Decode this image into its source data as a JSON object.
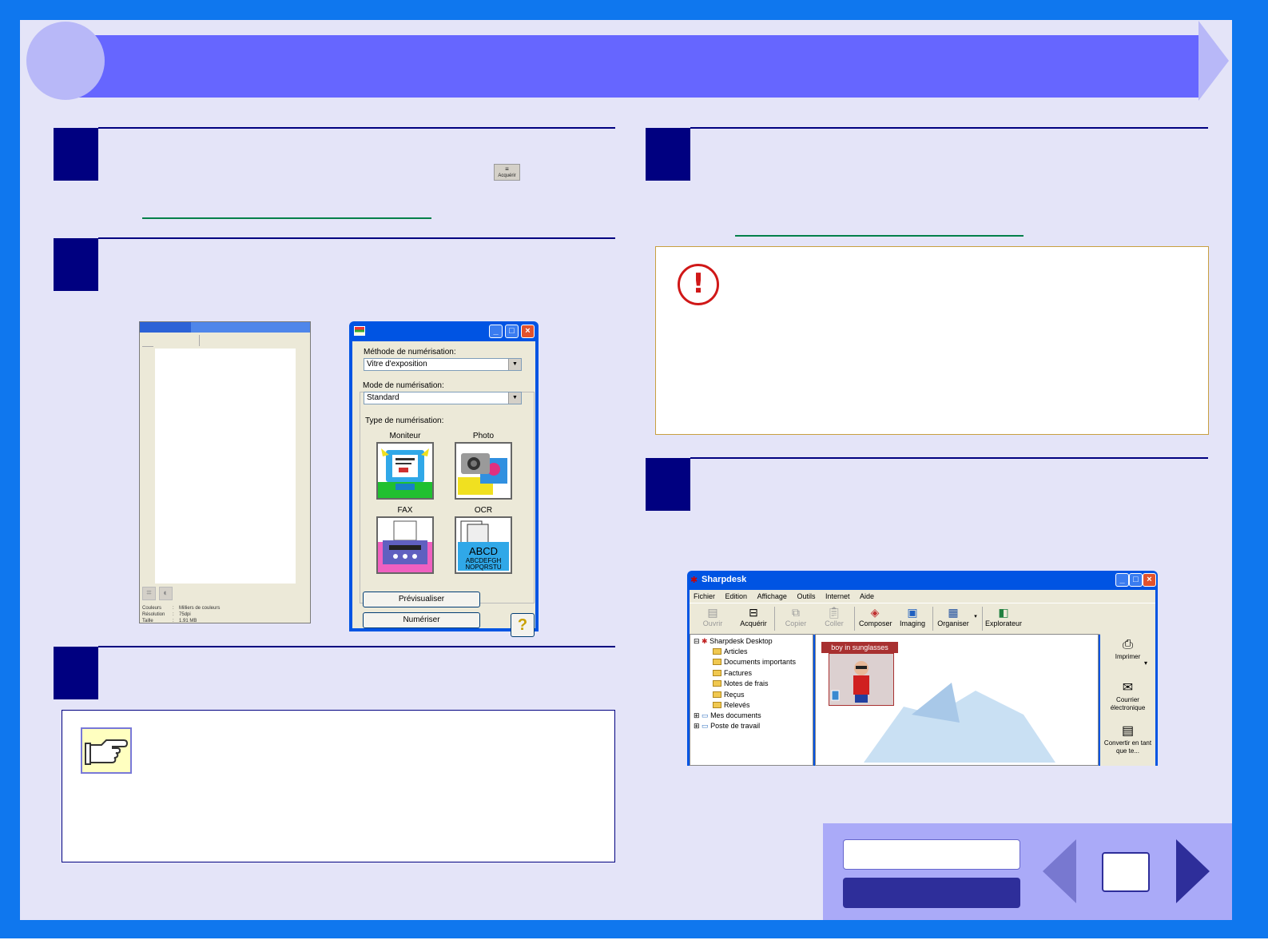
{
  "preview_window": {
    "info": [
      {
        "label": "Couleurs",
        "value": "Milliers de couleurs"
      },
      {
        "label": "Résolution",
        "value": "75dpi"
      },
      {
        "label": "Taille",
        "value": "1.91 MB"
      }
    ]
  },
  "acquire_button": {
    "label": "Acquérir"
  },
  "scan_dialog": {
    "method_label": "Méthode de numérisation:",
    "method_value": "Vitre d'exposition",
    "mode_label": "Mode de numérisation:",
    "mode_value": "Standard",
    "type_label": "Type de numérisation:",
    "tiles": [
      "Moniteur",
      "Photo",
      "FAX",
      "OCR"
    ],
    "ocr_text_1": "ABCD",
    "ocr_text_2": "ABCDEFGH",
    "ocr_text_3": "NOPQRSTU",
    "preview_button": "Prévisualiser",
    "scan_button": "Numériser",
    "help_glyph": "?"
  },
  "sharpdesk": {
    "title": "Sharpdesk",
    "menu": [
      "Fichier",
      "Edition",
      "Affichage",
      "Outils",
      "Internet",
      "Aide"
    ],
    "toolbar": [
      {
        "label": "Ouvrir",
        "enabled": false
      },
      {
        "label": "Acquérir",
        "enabled": true
      },
      {
        "label": "Copier",
        "enabled": false
      },
      {
        "label": "Coller",
        "enabled": false
      },
      {
        "label": "Composer",
        "enabled": true
      },
      {
        "label": "Imaging",
        "enabled": true
      },
      {
        "label": "Organiser",
        "enabled": true
      },
      {
        "label": "Explorateur",
        "enabled": true
      }
    ],
    "tree": {
      "root": "Sharpdesk Desktop",
      "folders": [
        "Articles",
        "Documents importants",
        "Factures",
        "Notes de frais",
        "Reçus",
        "Relevés"
      ],
      "others": [
        "Mes documents",
        "Poste de travail"
      ]
    },
    "thumbnail_caption": "boy in sunglasses",
    "side_actions": [
      "Imprimer",
      "Courrier électronique",
      "Convertir en tant que te..."
    ]
  },
  "colors": {
    "frame": "#0f77ee",
    "banner": "#6666ff",
    "step": "#000080",
    "link": "#00804a"
  }
}
